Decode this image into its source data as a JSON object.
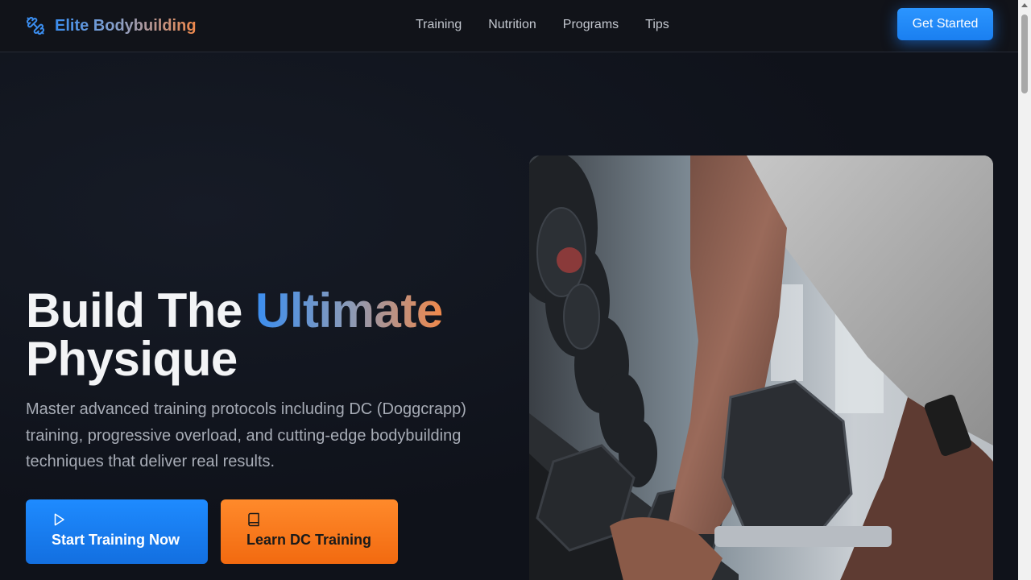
{
  "brand": {
    "name": "Elite Bodybuilding",
    "icon": "dumbbell-icon"
  },
  "nav": {
    "items": [
      {
        "label": "Training"
      },
      {
        "label": "Nutrition"
      },
      {
        "label": "Programs"
      },
      {
        "label": "Tips"
      }
    ],
    "cta_label": "Get Started"
  },
  "hero": {
    "headline_part1": "Build The ",
    "headline_accent": "Ultimate",
    "headline_part2": "Physique",
    "subtext": "Master advanced training protocols including DC (Doggcrapp) training, progressive overload, and cutting-edge bodybuilding techniques that deliver real results.",
    "primary_button": {
      "label": "Start Training Now",
      "icon": "play-icon"
    },
    "secondary_button": {
      "label": "Learn DC Training",
      "icon": "book-icon"
    },
    "image": "gym-dumbbell-rack-photo"
  },
  "colors": {
    "background": "#0f121a",
    "primary": "#1e8bff",
    "accent": "#f26a10"
  }
}
